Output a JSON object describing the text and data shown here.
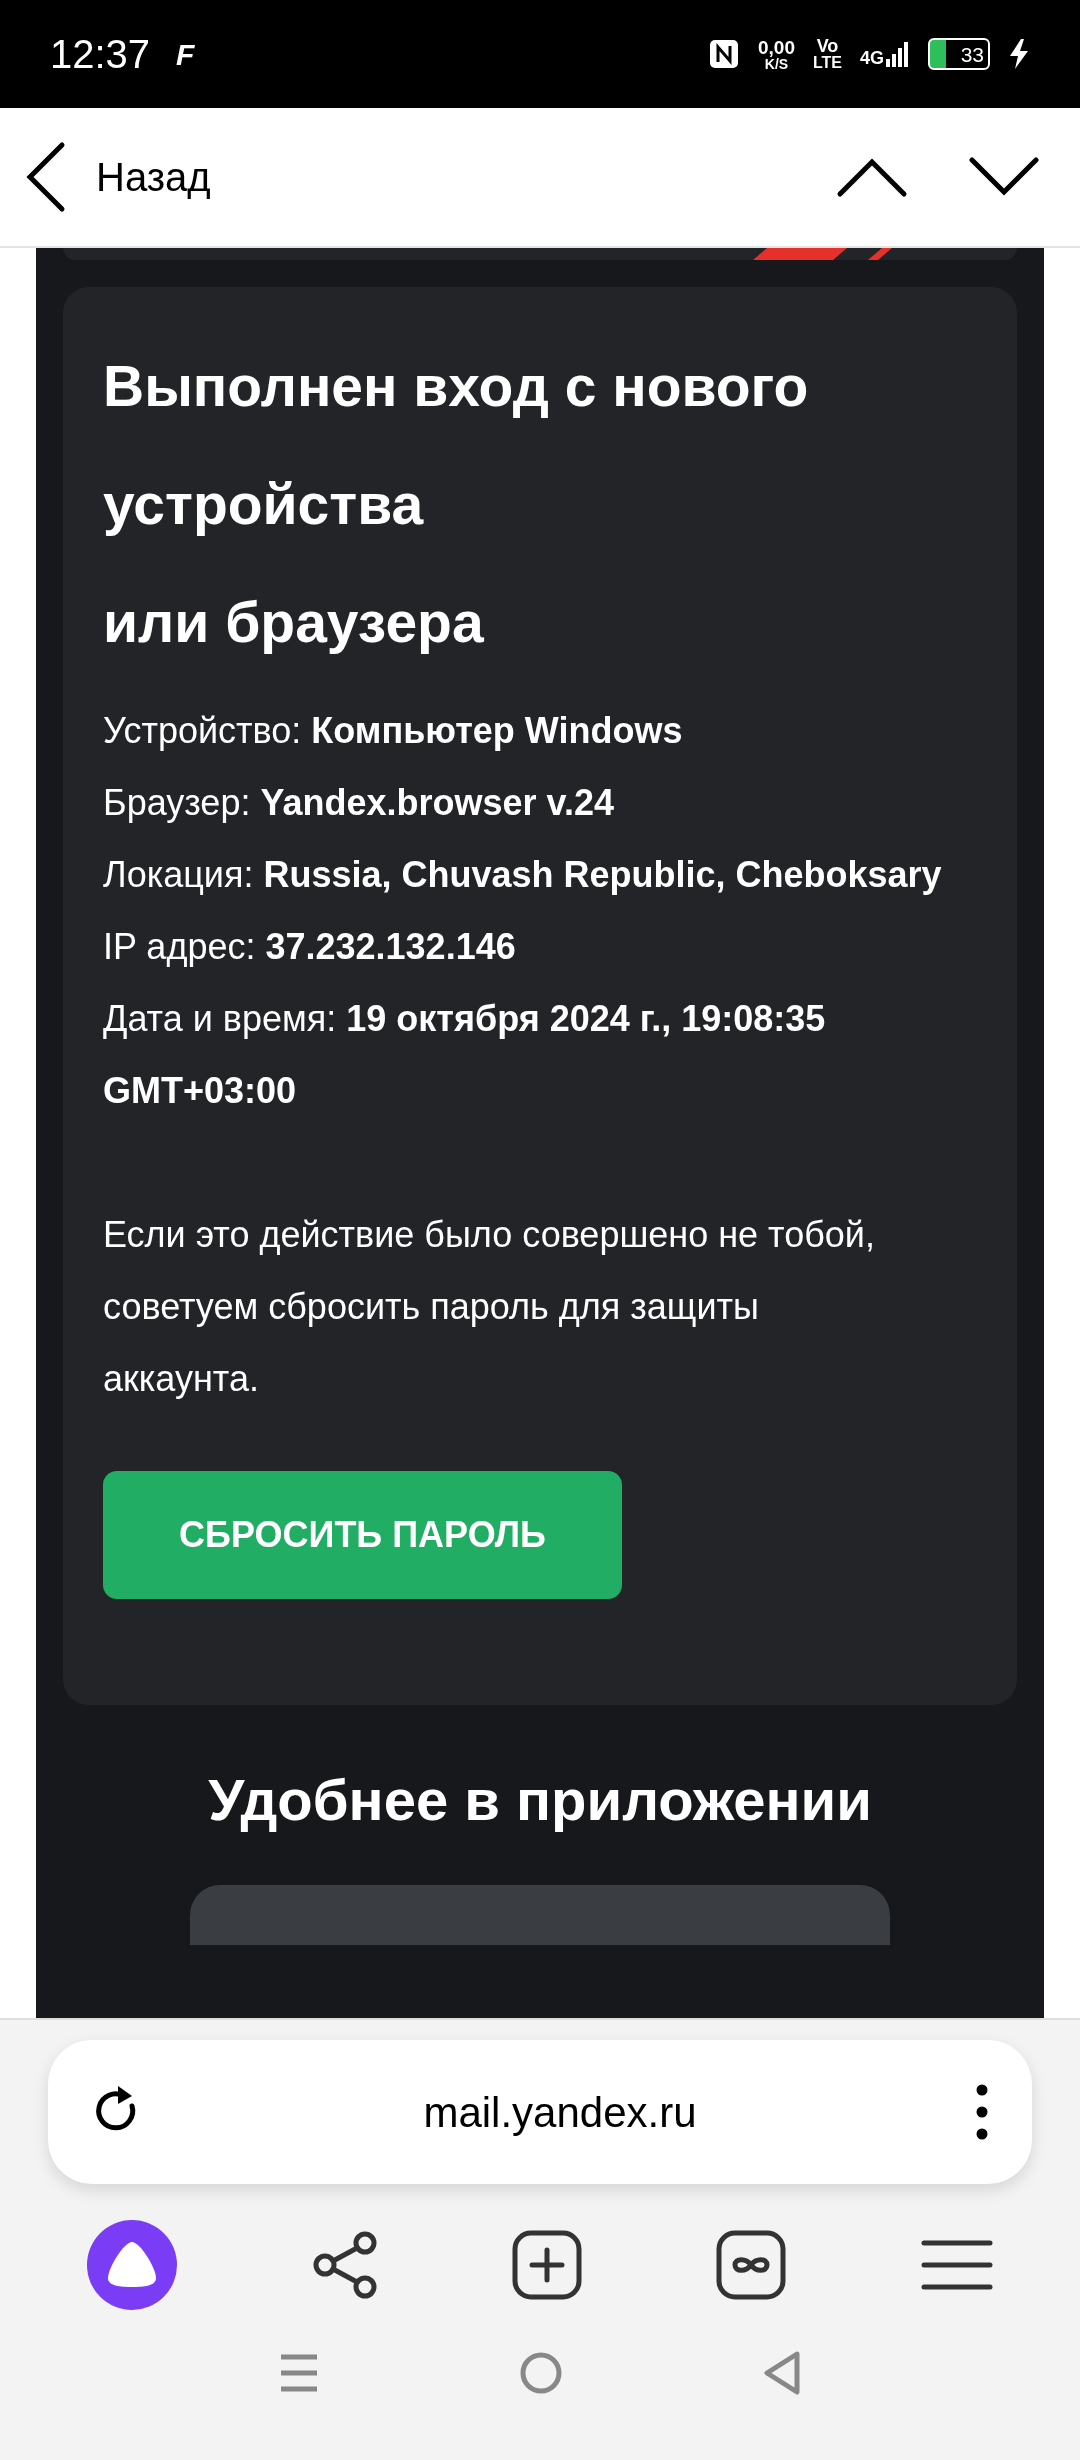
{
  "status_bar": {
    "time": "12:37",
    "carrier_mark": "F",
    "speed_value": "0,00",
    "speed_unit": "K/S",
    "volte_top": "Vo",
    "volte_bottom": "LTE",
    "network": "4G",
    "battery": "33"
  },
  "header": {
    "back_label": "Назад"
  },
  "card": {
    "title_lines": [
      "Выполнен вход с нового устройства",
      "или браузера"
    ],
    "details": [
      "Устройство: **Компьютер Windows**",
      "Браузер: **Yandex.browser v.24**",
      "Локация: **Russia, Chuvash Republic, Cheboksary**",
      "IP адрес: **37.232.132.146**",
      "Дата и время: **19 октября 2024 г., 19:08:35 GMT+03:00**"
    ],
    "note": "Если это действие было совершено не тобой, советуем сбросить пароль для защиты аккаунта.",
    "button": "СБРОСИТЬ ПАРОЛЬ"
  },
  "app_section": {
    "title": "Удобнее в приложении"
  },
  "address_bar": {
    "url": "mail.yandex.ru"
  }
}
